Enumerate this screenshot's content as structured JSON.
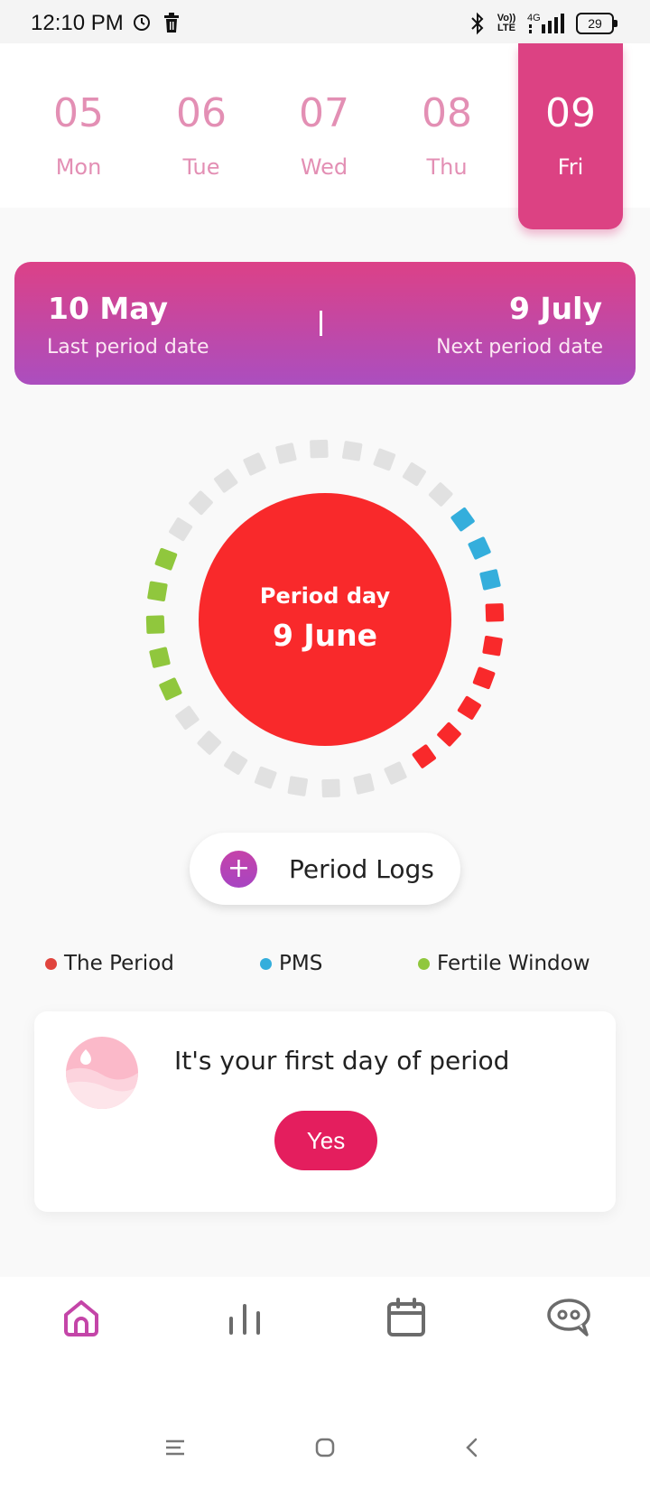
{
  "status_bar": {
    "time": "12:10 PM",
    "network_label_top": "Vo))",
    "network_label_bottom": "LTE",
    "network_gen": "4G",
    "battery": "29"
  },
  "date_strip": {
    "days": [
      {
        "num": "05",
        "name": "Mon"
      },
      {
        "num": "06",
        "name": "Tue"
      },
      {
        "num": "07",
        "name": "Wed"
      },
      {
        "num": "08",
        "name": "Thu"
      },
      {
        "num": "09",
        "name": "Fri",
        "selected": true
      }
    ]
  },
  "banner": {
    "last_date": "10 May",
    "last_label": "Last period date",
    "next_date": "9 July",
    "next_label": "Next period date"
  },
  "cycle": {
    "center_label": "Period day",
    "center_date": "9 June",
    "colors": {
      "period": "#f9292b",
      "pms": "#34aedc",
      "fertile": "#90c73d",
      "neutral": "#e1e1e1"
    }
  },
  "period_logs": {
    "label": "Period Logs",
    "icon": "plus-icon"
  },
  "legend": [
    {
      "label": "The Period",
      "color": "#e0443d"
    },
    {
      "label": "PMS",
      "color": "#34aedc"
    },
    {
      "label": "Fertile Window",
      "color": "#90c73d"
    }
  ],
  "card": {
    "message": "It's your first day of period",
    "yes_label": "Yes"
  },
  "bottom_nav": {
    "items": [
      "home-icon",
      "stats-icon",
      "calendar-icon",
      "chat-icon"
    ],
    "active_color": "#c445a8"
  },
  "accent": "#dc4283"
}
